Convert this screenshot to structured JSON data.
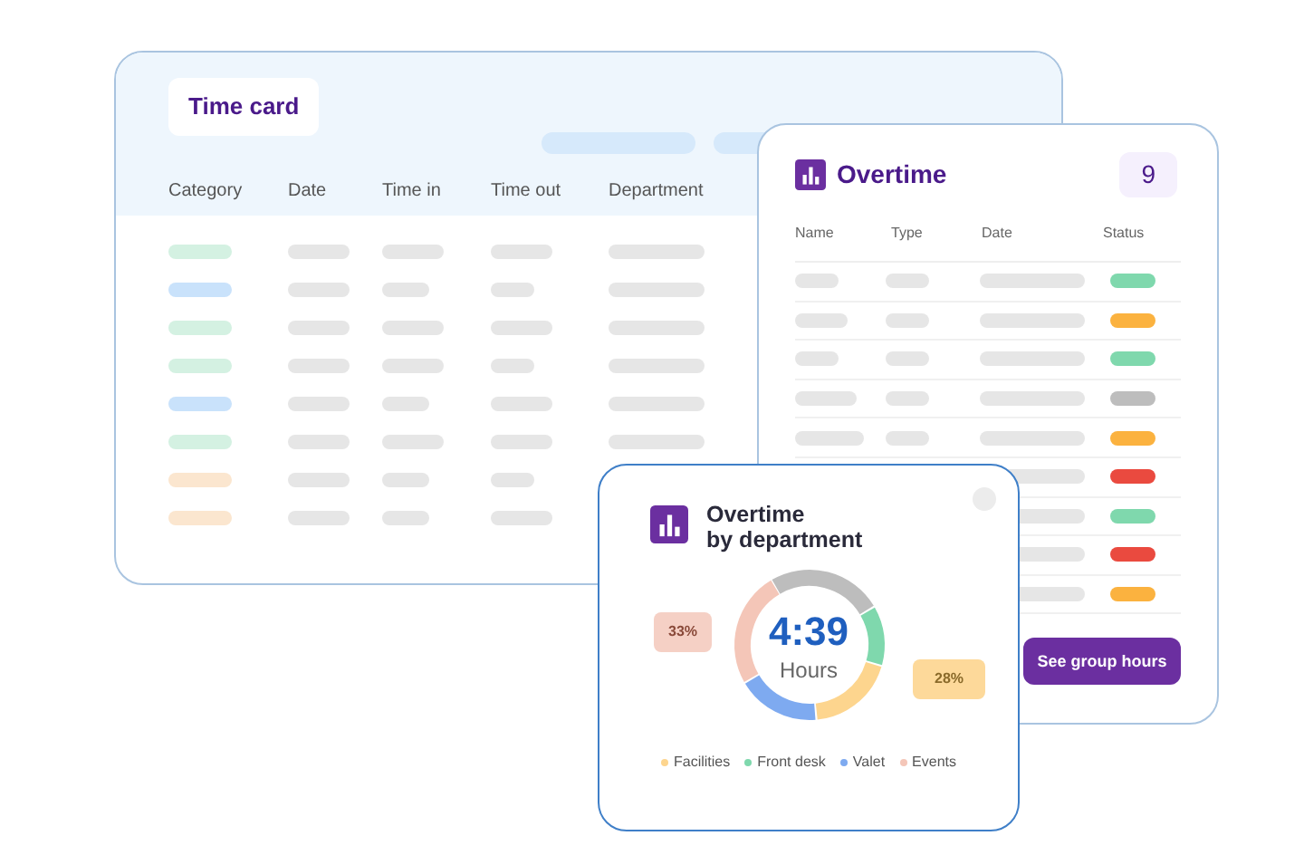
{
  "time_card": {
    "title": "Time card",
    "columns": [
      "Category",
      "Date",
      "Time in",
      "Time out",
      "Department"
    ],
    "rows": [
      {
        "color": "#d4f1e2"
      },
      {
        "color": "#c9e2fb"
      },
      {
        "color": "#d4f1e2"
      },
      {
        "color": "#d4f1e2"
      },
      {
        "color": "#c9e2fb"
      },
      {
        "color": "#d4f1e2"
      },
      {
        "color": "#fbe6cf"
      },
      {
        "color": "#fbe6cf"
      }
    ]
  },
  "overtime": {
    "title": "Overtime",
    "count": "9",
    "columns": [
      "Name",
      "Type",
      "Date",
      "Status"
    ],
    "rows": [
      {
        "color": "#7fd8ad"
      },
      {
        "color": "#fbb23f"
      },
      {
        "color": "#7fd8ad"
      },
      {
        "color": "#bdbdbd"
      },
      {
        "color": "#fbb23f"
      },
      {
        "color": "#ea4a3f"
      },
      {
        "color": "#7fd8ad"
      },
      {
        "color": "#ea4a3f"
      },
      {
        "color": "#fbb23f"
      }
    ],
    "button": "See group hours"
  },
  "department": {
    "title_lines": [
      "Overtime",
      "by department"
    ],
    "total": "4:39",
    "unit": "Hours",
    "callouts": [
      "33%",
      "28%"
    ],
    "legend": [
      {
        "label": "Facilities",
        "color": "#fdd58e"
      },
      {
        "label": "Front desk",
        "color": "#7fd8ad"
      },
      {
        "label": "Valet",
        "color": "#7eaaf0"
      },
      {
        "label": "Events",
        "color": "#f4c6b8"
      }
    ]
  }
}
